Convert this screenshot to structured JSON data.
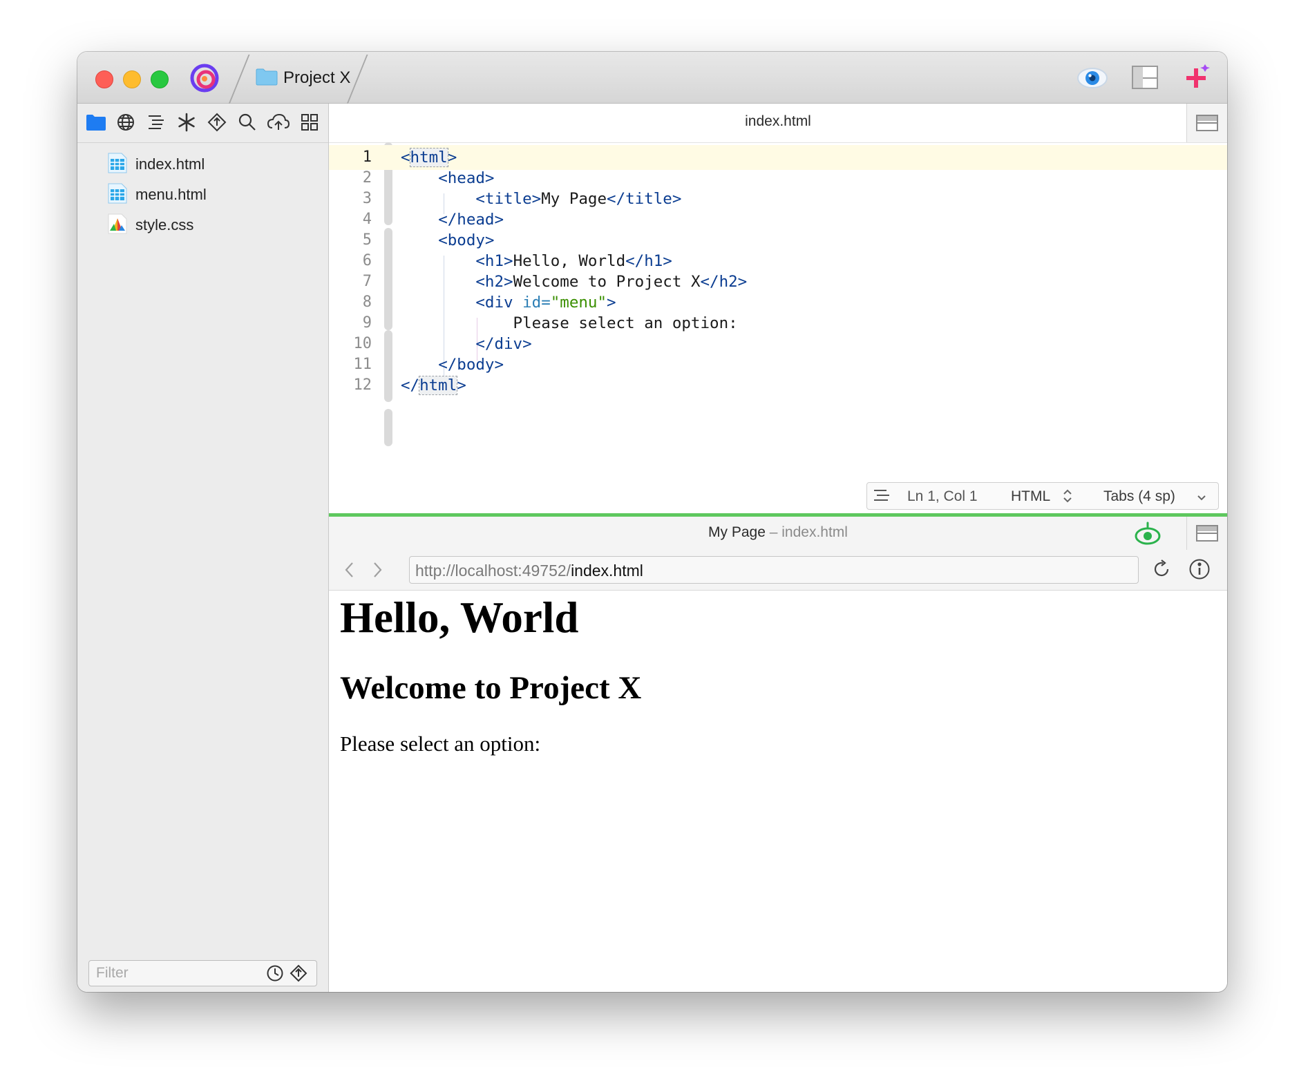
{
  "titlebar": {
    "project_label": "Project X"
  },
  "sidebar": {
    "files": [
      {
        "name": "index.html",
        "icon": "html-file-icon"
      },
      {
        "name": "menu.html",
        "icon": "html-file-icon"
      },
      {
        "name": "style.css",
        "icon": "css-file-icon"
      }
    ],
    "filter_placeholder": "Filter"
  },
  "editor": {
    "filename": "index.html",
    "line_numbers": [
      "1",
      "2",
      "3",
      "4",
      "5",
      "6",
      "7",
      "8",
      "9",
      "10",
      "11",
      "12"
    ],
    "current_line": 1,
    "status": {
      "position": "Ln 1, Col 1",
      "language": "HTML",
      "indent": "Tabs (4 sp)"
    }
  },
  "preview": {
    "page_title": "My Page",
    "separator": " – ",
    "file": "index.html",
    "url_host": "http://localhost:49752/",
    "url_path": "index.html",
    "content": {
      "h1": "Hello, World",
      "h2": "Welcome to Project X",
      "p": "Please select an option:"
    }
  },
  "colors": {
    "tag": "#0b3d91",
    "attr": "#2d7fb5",
    "string": "#3a8f00",
    "accent_green": "#5ec85e"
  }
}
